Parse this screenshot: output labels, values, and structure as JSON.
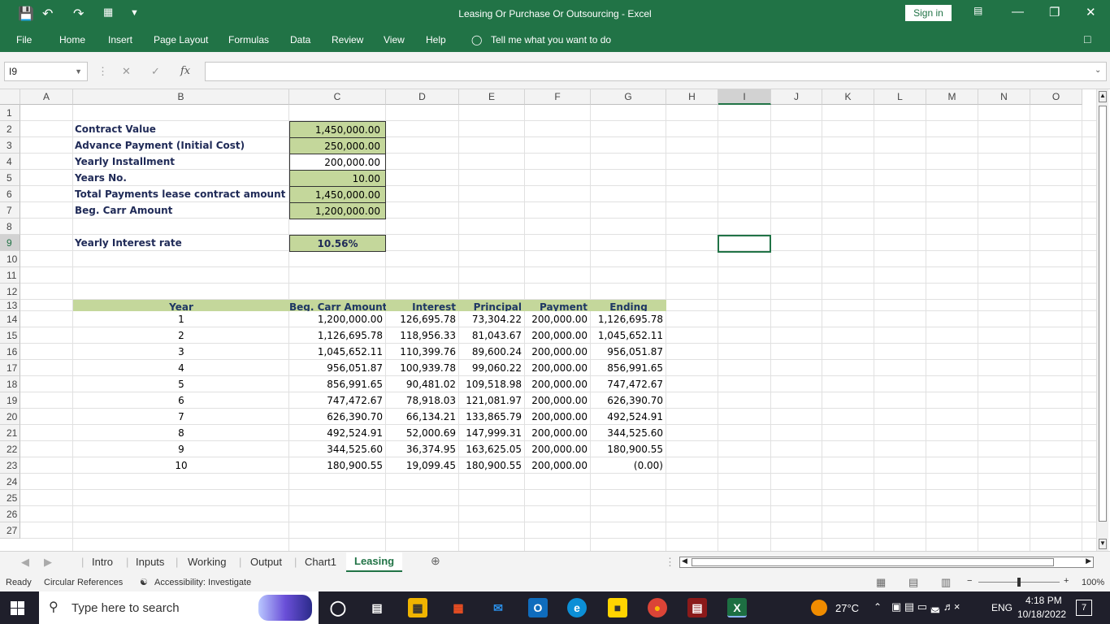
{
  "app": {
    "title": "Leasing Or Purchase Or Outsourcing  -  Excel",
    "sign_in": "Sign in"
  },
  "ribbon": {
    "tabs": [
      "File",
      "Home",
      "Insert",
      "Page Layout",
      "Formulas",
      "Data",
      "Review",
      "View",
      "Help"
    ],
    "tell_me": "Tell me what you want to do"
  },
  "formula_bar": {
    "name_box": "I9",
    "fx": "fx",
    "formula": ""
  },
  "columns": [
    "A",
    "B",
    "C",
    "D",
    "E",
    "F",
    "G",
    "H",
    "I",
    "J",
    "K",
    "L",
    "M",
    "N",
    "O"
  ],
  "rows": [
    "1",
    "2",
    "3",
    "4",
    "5",
    "6",
    "7",
    "8",
    "9",
    "10",
    "11",
    "12",
    "13",
    "14",
    "15",
    "16",
    "17",
    "18",
    "19",
    "20",
    "21",
    "22",
    "23",
    "24",
    "25",
    "26",
    "27"
  ],
  "inputs": [
    {
      "label": "Contract Value",
      "value": "1,450,000.00"
    },
    {
      "label": "Advance Payment (Initial Cost)",
      "value": "250,000.00"
    },
    {
      "label": "Yearly  Installment",
      "value": "200,000.00"
    },
    {
      "label": "Years No.",
      "value": "10.00"
    },
    {
      "label": "Total Payments lease contract amount",
      "value": "1,450,000.00"
    },
    {
      "label": "Beg. Carr Amount",
      "value": "1,200,000.00"
    }
  ],
  "rate": {
    "label": "Yearly Interest rate",
    "value": "10.56%"
  },
  "table": {
    "headers": [
      "Year",
      "Beg. Carr Amount",
      "Interest",
      "Principal",
      "Payment",
      "Ending"
    ],
    "rows": [
      [
        "1",
        "1,200,000.00",
        "126,695.78",
        "73,304.22",
        "200,000.00",
        "1,126,695.78"
      ],
      [
        "2",
        "1,126,695.78",
        "118,956.33",
        "81,043.67",
        "200,000.00",
        "1,045,652.11"
      ],
      [
        "3",
        "1,045,652.11",
        "110,399.76",
        "89,600.24",
        "200,000.00",
        "956,051.87"
      ],
      [
        "4",
        "956,051.87",
        "100,939.78",
        "99,060.22",
        "200,000.00",
        "856,991.65"
      ],
      [
        "5",
        "856,991.65",
        "90,481.02",
        "109,518.98",
        "200,000.00",
        "747,472.67"
      ],
      [
        "6",
        "747,472.67",
        "78,918.03",
        "121,081.97",
        "200,000.00",
        "626,390.70"
      ],
      [
        "7",
        "626,390.70",
        "66,134.21",
        "133,865.79",
        "200,000.00",
        "492,524.91"
      ],
      [
        "8",
        "492,524.91",
        "52,000.69",
        "147,999.31",
        "200,000.00",
        "344,525.60"
      ],
      [
        "9",
        "344,525.60",
        "36,374.95",
        "163,625.05",
        "200,000.00",
        "180,900.55"
      ],
      [
        "10",
        "180,900.55",
        "19,099.45",
        "180,900.55",
        "200,000.00",
        "(0.00)"
      ]
    ]
  },
  "sheets": [
    "Intro",
    "Inputs",
    "Working",
    "Output",
    "Chart1",
    "Leasing"
  ],
  "active_sheet": "Leasing",
  "status": {
    "ready": "Ready",
    "circular": "Circular References",
    "accessibility": "Accessibility: Investigate",
    "zoom": "100%"
  },
  "taskbar": {
    "search": "Type here to search",
    "temp": "27°C",
    "lang": "ENG",
    "time": "4:18 PM",
    "date": "10/18/2022",
    "notif": "7"
  }
}
